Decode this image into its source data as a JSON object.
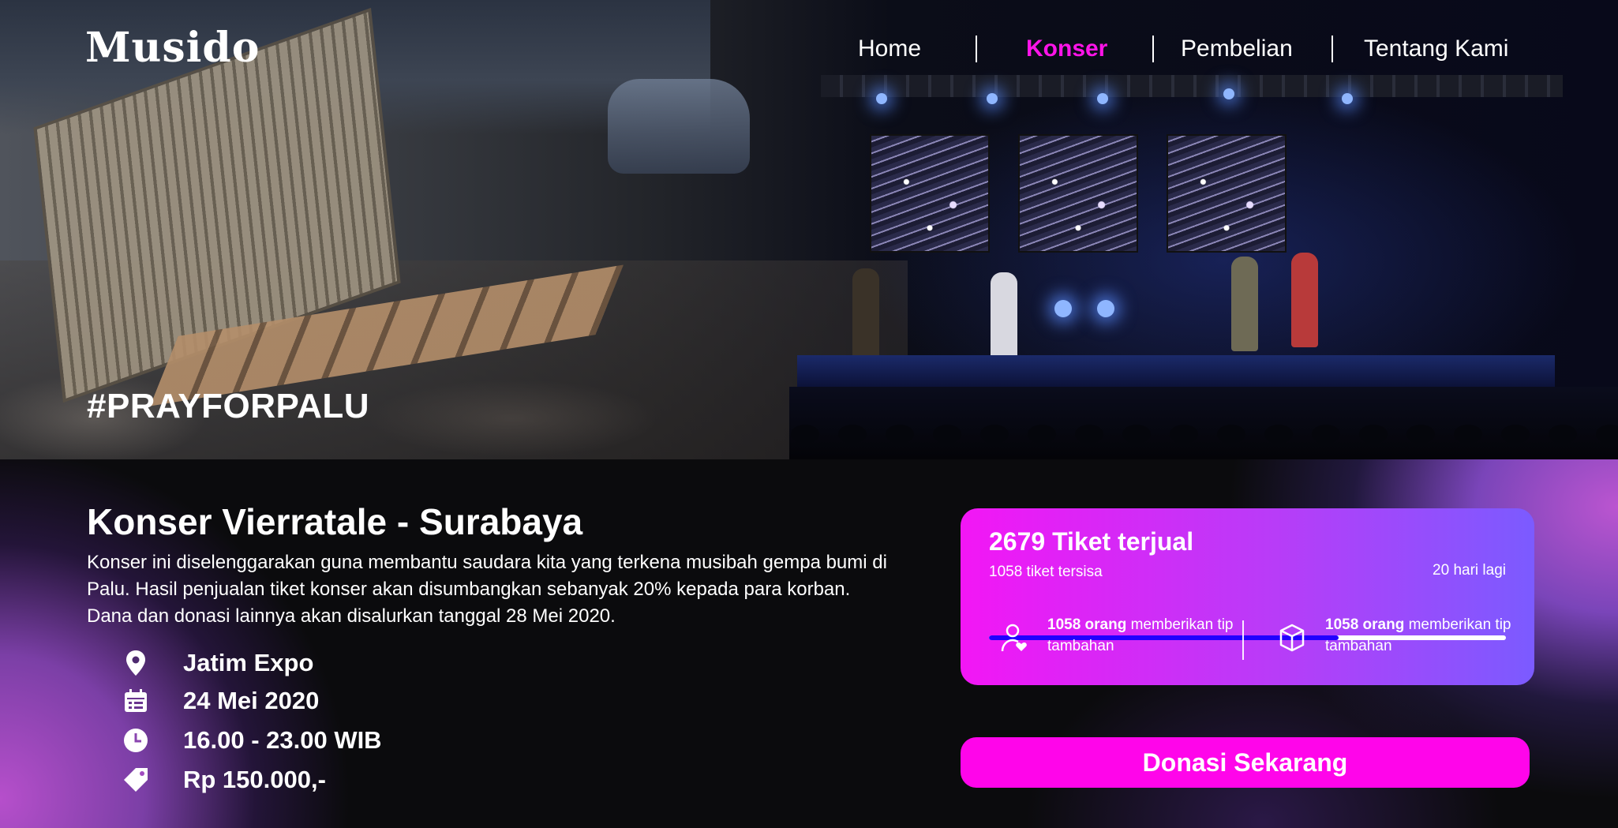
{
  "brand": {
    "logo": "Musido"
  },
  "nav": {
    "items": [
      {
        "label": "Home",
        "active": false
      },
      {
        "label": "Konser",
        "active": true
      },
      {
        "label": "Pembelian",
        "active": false
      },
      {
        "label": "Tentang Kami",
        "active": false
      }
    ]
  },
  "hero": {
    "hashtag": "#PRAYFORPALU"
  },
  "concert": {
    "title": "Konser Vierratale - Surabaya",
    "description": "Konser ini diselenggarakan guna membantu saudara kita yang terkena musibah gempa bumi di Palu. Hasil penjualan tiket konser akan disumbangkan sebanyak 20% kepada para korban. Dana dan donasi lainnya akan disalurkan tanggal 28 Mei 2020.",
    "details": [
      {
        "icon": "location-pin-icon",
        "text": "Jatim Expo"
      },
      {
        "icon": "calendar-icon",
        "text": "24 Mei 2020"
      },
      {
        "icon": "clock-icon",
        "text": "16.00 - 23.00 WIB"
      },
      {
        "icon": "price-tag-icon",
        "text": "Rp 150.000,-"
      }
    ]
  },
  "tickets": {
    "sold": "2679 Tiket terjual",
    "remaining": "1058 tiket tersisa",
    "days_left": "20 hari lagi",
    "progress_fraction": 0.677,
    "stats": [
      {
        "icon": "user-heart-icon",
        "count": "1058 orang",
        "text": " memberikan tip tambahan"
      },
      {
        "icon": "box-icon",
        "count": "1058 orang",
        "text": " memberikan tip tambahan"
      }
    ]
  },
  "cta": {
    "donate_label": "Donasi Sekarang"
  },
  "colors": {
    "accent": "#ff14e8",
    "progress": "#2200ff",
    "card_start": "#f316f5",
    "card_end": "#7b5bff"
  }
}
